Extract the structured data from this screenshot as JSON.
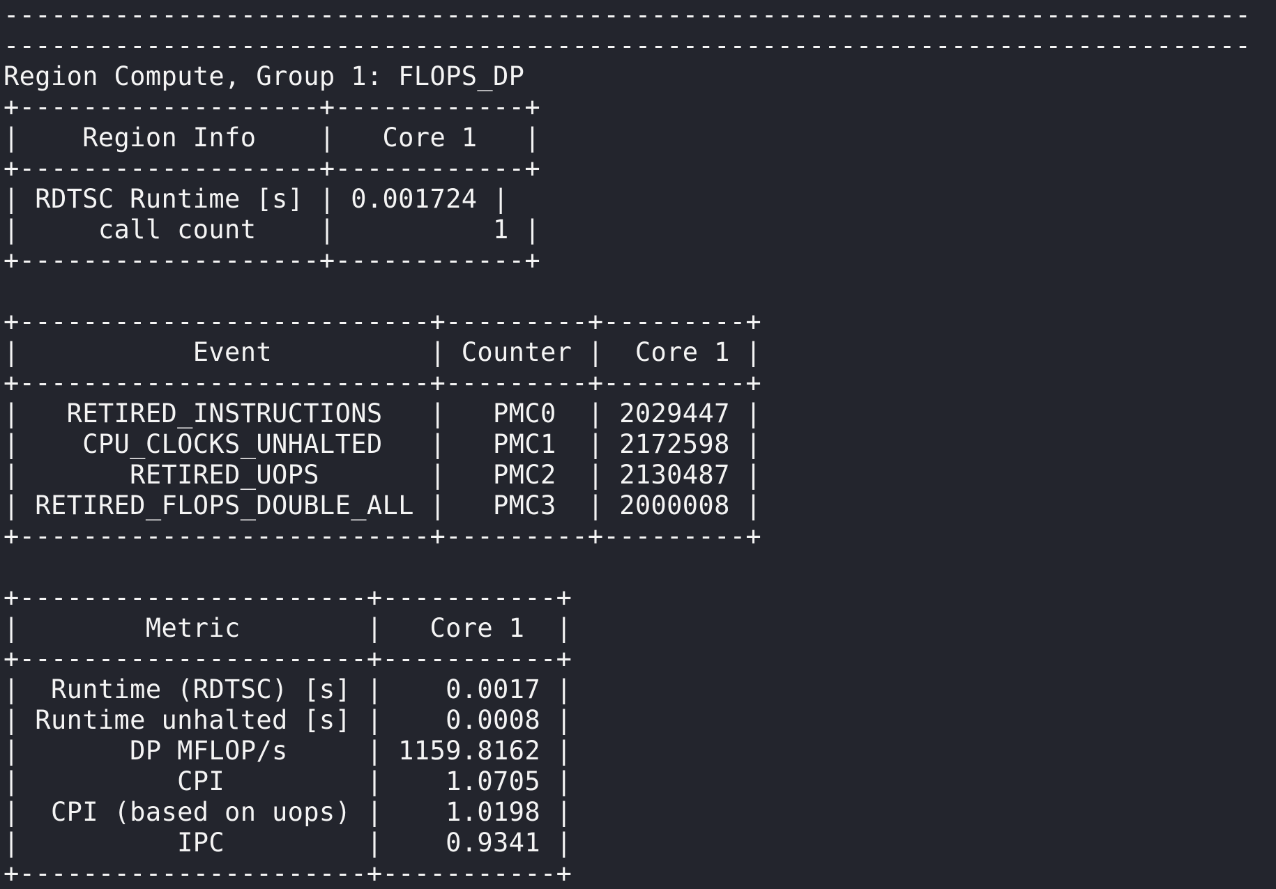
{
  "terminal": {
    "lines": [
      "-------------------------------------------------------------------------------",
      "-------------------------------------------------------------------------------",
      "Region Compute, Group 1: FLOPS_DP",
      "+-------------------+------------+",
      "|    Region Info    |   Core 1   |",
      "+-------------------+------------+",
      "| RDTSC Runtime [s] | 0.001724 |",
      "|     call count    |          1 |",
      "+-------------------+------------+",
      "",
      "+--------------------------+---------+---------+",
      "|           Event          | Counter |  Core 1 |",
      "+--------------------------+---------+---------+",
      "|   RETIRED_INSTRUCTIONS   |   PMC0  | 2029447 |",
      "|    CPU_CLOCKS_UNHALTED   |   PMC1  | 2172598 |",
      "|       RETIRED_UOPS       |   PMC2  | 2130487 |",
      "| RETIRED_FLOPS_DOUBLE_ALL |   PMC3  | 2000008 |",
      "+--------------------------+---------+---------+",
      "",
      "+----------------------+-----------+",
      "|        Metric        |   Core 1  |",
      "+----------------------+-----------+",
      "|  Runtime (RDTSC) [s] |    0.0017 |",
      "| Runtime unhalted [s] |    0.0008 |",
      "|       DP MFLOP/s     | 1159.8162 |",
      "|          CPI         |    1.0705 |",
      "|  CPI (based on uops) |    1.0198 |",
      "|          IPC         |    0.9341 |",
      "+----------------------+-----------+"
    ]
  },
  "colors": {
    "background": "#23252d",
    "text": "#f4f4f4"
  }
}
